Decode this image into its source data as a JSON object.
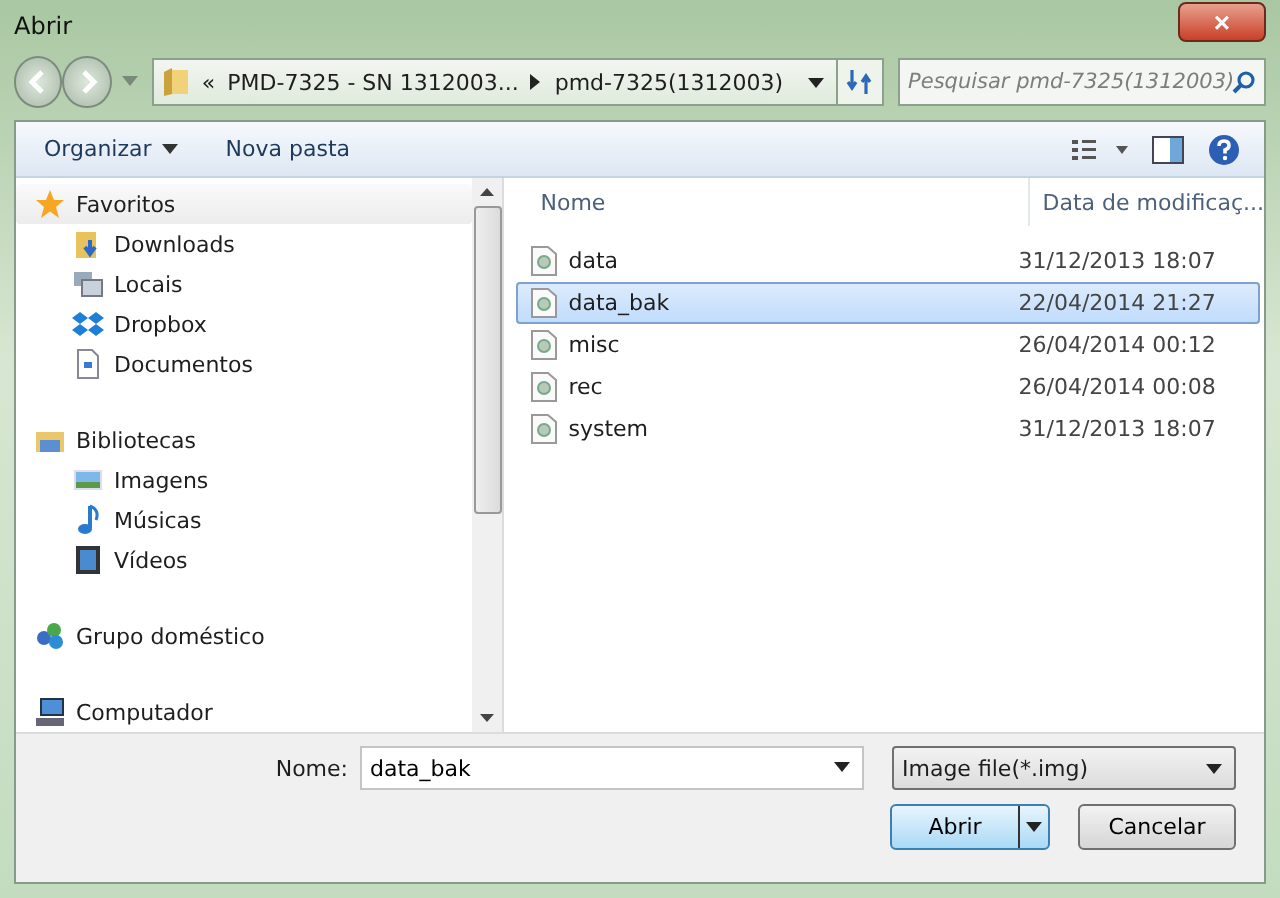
{
  "window": {
    "title": "Abrir",
    "close": "×"
  },
  "address": {
    "overflow": "«",
    "crumbs": [
      "PMD-7325 - SN 1312003...",
      "pmd-7325(1312003)"
    ]
  },
  "search": {
    "placeholder": "Pesquisar pmd-7325(1312003)"
  },
  "toolbar": {
    "organize": "Organizar",
    "new_folder": "Nova pasta"
  },
  "sidebar": {
    "groups": [
      {
        "label": "Favoritos",
        "children": [
          {
            "label": "Downloads"
          },
          {
            "label": "Locais"
          },
          {
            "label": "Dropbox"
          },
          {
            "label": "Documentos"
          }
        ]
      },
      {
        "label": "Bibliotecas",
        "children": [
          {
            "label": "Imagens"
          },
          {
            "label": "Músicas"
          },
          {
            "label": "Vídeos"
          }
        ]
      },
      {
        "label": "Grupo doméstico"
      },
      {
        "label": "Computador"
      }
    ]
  },
  "table": {
    "columns": [
      "Nome",
      "Data de modificaç..."
    ],
    "rows": [
      {
        "name": "data",
        "date": "31/12/2013 18:07",
        "selected": false
      },
      {
        "name": "data_bak",
        "date": "22/04/2014 21:27",
        "selected": true
      },
      {
        "name": "misc",
        "date": "26/04/2014 00:12",
        "selected": false
      },
      {
        "name": "rec",
        "date": "26/04/2014 00:08",
        "selected": false
      },
      {
        "name": "system",
        "date": "31/12/2013 18:07",
        "selected": false
      }
    ]
  },
  "filename": {
    "label": "Nome:",
    "value": "data_bak"
  },
  "filetype": {
    "value": "Image file(*.img)"
  },
  "buttons": {
    "open": "Abrir",
    "cancel": "Cancelar"
  }
}
